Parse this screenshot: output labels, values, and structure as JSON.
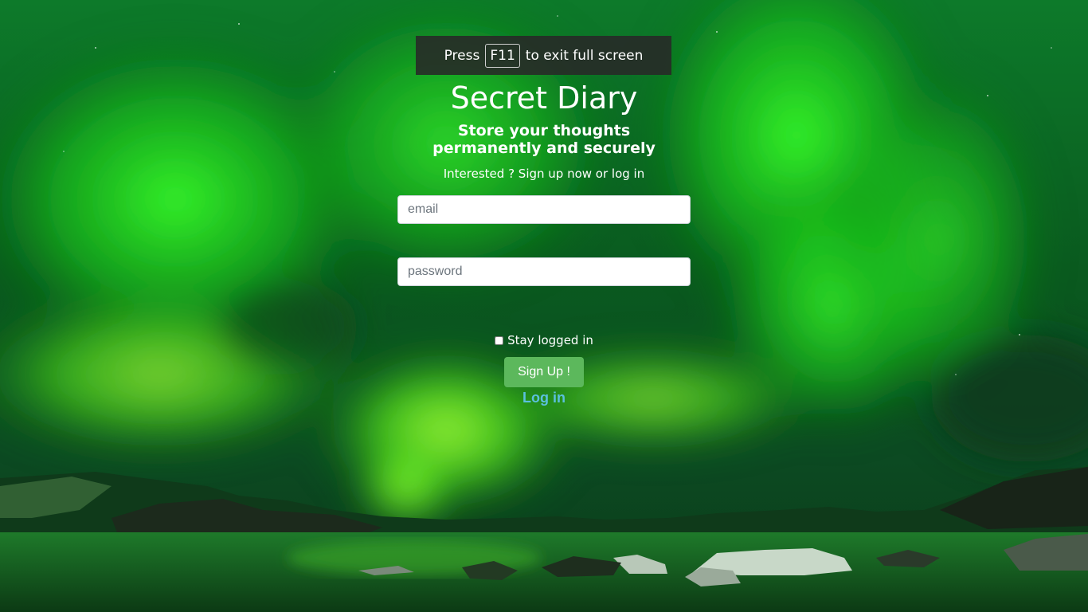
{
  "fullscreen_notice": {
    "before": "Press",
    "key": "F11",
    "after": "to exit full screen"
  },
  "hero": {
    "title": "Secret Diary",
    "subtitle": "Store your thoughts permanently and securely",
    "hint": "Interested ? Sign up now or log in"
  },
  "form": {
    "email_placeholder": "email",
    "password_placeholder": "password",
    "stay_logged_in_label": "Stay logged in",
    "stay_logged_in_checked": false,
    "signup_label": "Sign Up !",
    "login_label": "Log in"
  },
  "colors": {
    "signup_button": "#5cb85c",
    "login_link": "#5bc0de",
    "aurora": "#33ff22"
  },
  "background": {
    "description_icon": "aurora-landscape"
  }
}
